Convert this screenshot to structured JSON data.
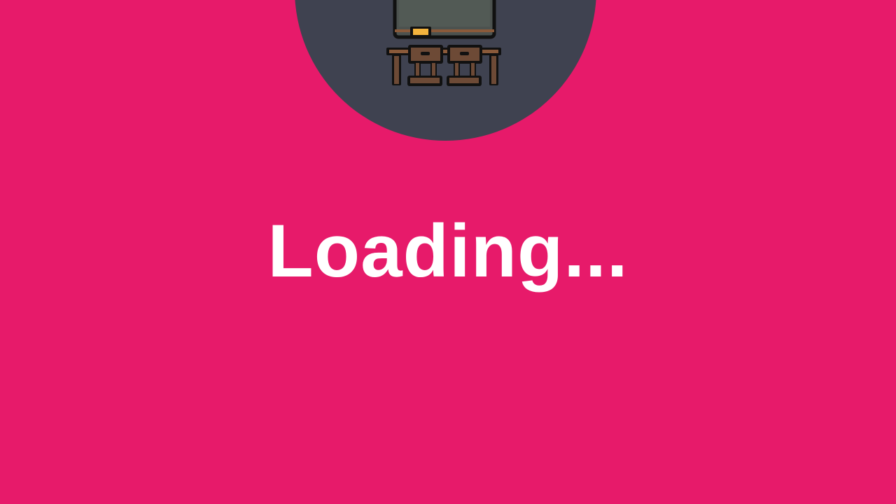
{
  "screen": {
    "background_color": "#e71a6a",
    "logo_circle_color": "#3f4250",
    "text_color": "#ffffff"
  },
  "logo": {
    "icon": "classroom-icon"
  },
  "status": {
    "message": "Loading..."
  }
}
